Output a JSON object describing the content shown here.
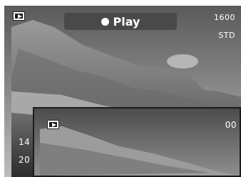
{
  "back_screen": {
    "mode_label": "Play",
    "image_size": "1600",
    "quality": "STD",
    "peek_left_top": "14",
    "peek_left_bottom": "20"
  },
  "front_screen": {
    "peek_right_top": "00"
  },
  "icons": {
    "mode": "playback-icon",
    "indicator": "dot-icon"
  }
}
